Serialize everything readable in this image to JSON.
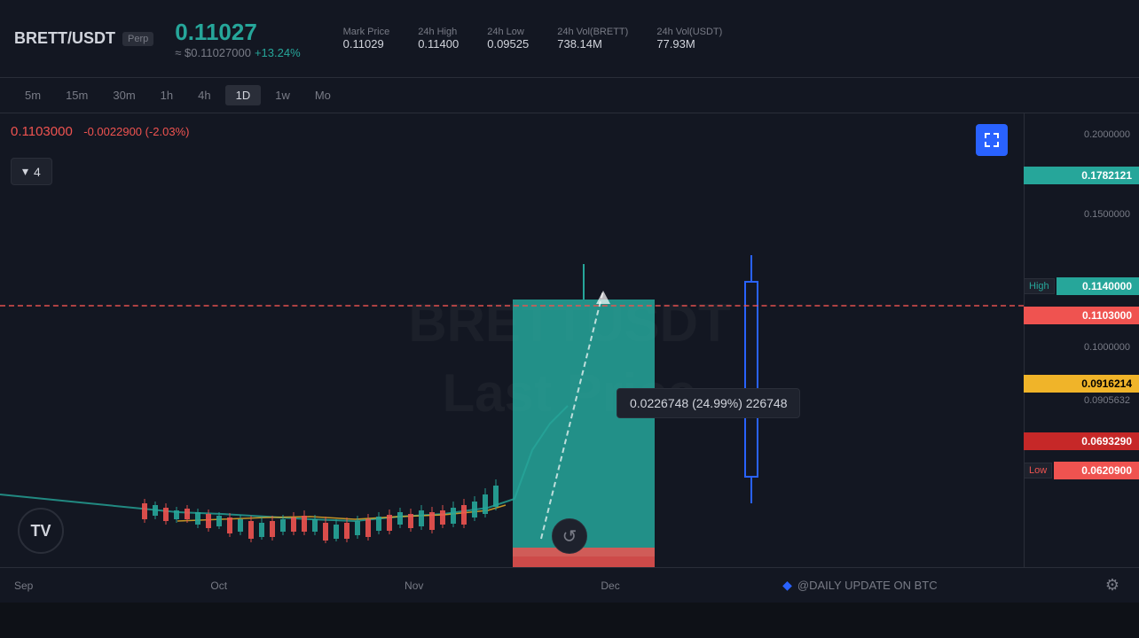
{
  "header": {
    "pair": "BRETT/USDT",
    "perp_label": "Perp",
    "current_price": "0.11027",
    "price_usd": "≈ $0.11027000",
    "price_change": "+13.24%",
    "mark_price_label": "Mark Price",
    "mark_price_value": "0.11029",
    "high_24h_label": "24h High",
    "high_24h_value": "0.11400",
    "low_24h_label": "24h Low",
    "low_24h_value": "0.09525",
    "vol_brett_label": "24h Vol(BRETT)",
    "vol_brett_value": "738.14M",
    "vol_usdt_label": "24h Vol(USDT)",
    "vol_usdt_value": "77.93M"
  },
  "timeframes": [
    "5m",
    "15m",
    "30m",
    "1h",
    "4h",
    "1D",
    "1w",
    "Mo"
  ],
  "active_timeframe": "1D",
  "chart": {
    "price_display": "0.1103000",
    "price_change_display": "-0.0022900 (-2.03%)",
    "dropdown_value": "4",
    "tooltip_text": "0.0226748 (24.99%) 226748",
    "watermark_line1": "BRETTUSDT",
    "watermark_line2": "Last Price",
    "price_levels": [
      {
        "value": "0.2000000",
        "top_pct": 5
      },
      {
        "value": "0.1782121",
        "top_pct": 12,
        "badge": "teal"
      },
      {
        "value": "0.1500000",
        "top_pct": 22
      },
      {
        "value": "0.1140000",
        "top_pct": 36,
        "badge_high": true
      },
      {
        "value": "0.1103000",
        "top_pct": 40,
        "badge": "red"
      },
      {
        "value": "0.1000000",
        "top_pct": 48
      },
      {
        "value": "0.0916214",
        "top_pct": 54,
        "badge": "yellow"
      },
      {
        "value": "0.0905632",
        "top_pct": 57
      },
      {
        "value": "0.0693290",
        "top_pct": 66,
        "badge": "dark-red"
      },
      {
        "value": "0.0620900",
        "top_pct": 72,
        "badge_low": true
      }
    ]
  },
  "time_labels": [
    "Sep",
    "Oct",
    "Nov",
    "Dec"
  ],
  "high_label": "High",
  "high_value": "0.1140000",
  "low_label": "Low",
  "low_value": "0.0620900",
  "daily_update_text": "@DAILY UPDATE ON BTC",
  "icons": {
    "chevron_down": "▾",
    "reset": "↺",
    "settings": "⚙",
    "expand": "⛶",
    "diamond": "◆"
  }
}
